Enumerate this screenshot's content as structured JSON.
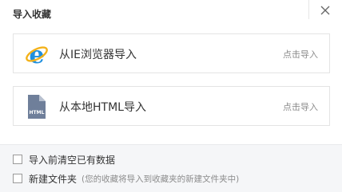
{
  "dialog": {
    "title": "导入收藏",
    "close_icon": "close-icon"
  },
  "sources": [
    {
      "icon": "ie-browser-icon",
      "label": "从IE浏览器导入",
      "action": "点击导入"
    },
    {
      "icon": "html-file-icon",
      "label": "从本地HTML导入",
      "action": "点击导入",
      "icon_text": "HTML"
    }
  ],
  "options": {
    "clear_existing": {
      "label": "导入前清空已有数据",
      "checked": false
    },
    "new_folder": {
      "label": "新建文件夹",
      "hint": "(您的收藏将导入到收藏夹的新建文件夹中)",
      "checked": false
    }
  },
  "colors": {
    "ie_blue": "#1f8fde",
    "ie_ring": "#f3b21a",
    "file_icon": "#6f7f9a",
    "footer_bg": "#f5f6f8"
  }
}
